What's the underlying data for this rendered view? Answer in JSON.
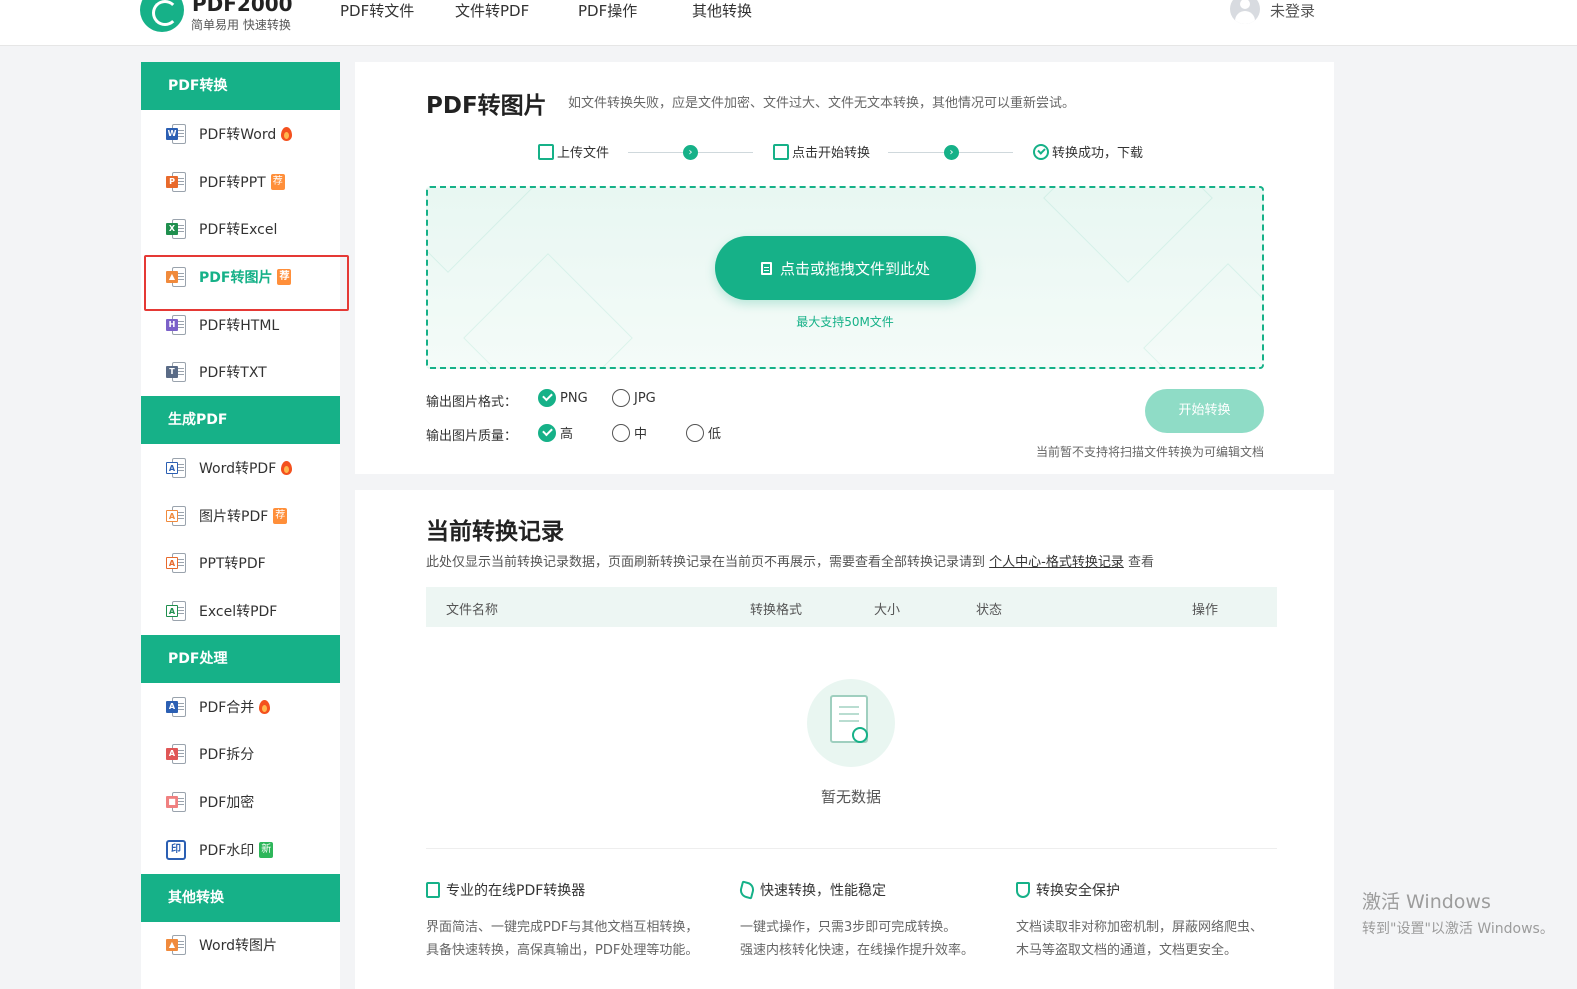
{
  "header": {
    "brand_name": "PDF2000",
    "brand_slogan": "简单易用 快速转换",
    "nav": [
      "PDF转文件",
      "文件转PDF",
      "PDF操作",
      "其他转换"
    ],
    "user_label": "未登录"
  },
  "sidebar": {
    "sections": [
      {
        "title": "PDF转换",
        "items": [
          {
            "label": "PDF转Word",
            "icon": "word-file-icon",
            "badge": "fire"
          },
          {
            "label": "PDF转PPT",
            "icon": "ppt-file-icon",
            "badge": "荐"
          },
          {
            "label": "PDF转Excel",
            "icon": "excel-file-icon",
            "badge": ""
          },
          {
            "label": "PDF转图片",
            "icon": "image-file-icon",
            "badge": "荐",
            "active": true
          },
          {
            "label": "PDF转HTML",
            "icon": "html-file-icon",
            "badge": ""
          },
          {
            "label": "PDF转TXT",
            "icon": "txt-file-icon",
            "badge": ""
          }
        ]
      },
      {
        "title": "生成PDF",
        "items": [
          {
            "label": "Word转PDF",
            "icon": "word-to-pdf-icon",
            "badge": "fire"
          },
          {
            "label": "图片转PDF",
            "icon": "image-to-pdf-icon",
            "badge": "荐"
          },
          {
            "label": "PPT转PDF",
            "icon": "ppt-to-pdf-icon",
            "badge": ""
          },
          {
            "label": "Excel转PDF",
            "icon": "excel-to-pdf-icon",
            "badge": ""
          }
        ]
      },
      {
        "title": "PDF处理",
        "items": [
          {
            "label": "PDF合并",
            "icon": "pdf-merge-icon",
            "badge": "fire"
          },
          {
            "label": "PDF拆分",
            "icon": "pdf-split-icon",
            "badge": ""
          },
          {
            "label": "PDF加密",
            "icon": "pdf-lock-icon",
            "badge": ""
          },
          {
            "label": "PDF水印",
            "icon": "watermark-icon",
            "badge": "新"
          }
        ]
      },
      {
        "title": "其他转换",
        "items": [
          {
            "label": "Word转图片",
            "icon": "word-to-image-icon",
            "badge": ""
          }
        ]
      }
    ]
  },
  "converter": {
    "title": "PDF转图片",
    "tip": "如文件转换失败，应是文件加密、文件过大、文件无文本转换，其他情况可以重新尝试。",
    "steps": [
      "上传文件",
      "点击开始转换",
      "转换成功，下载"
    ],
    "upload_label": "点击或拖拽文件到此处",
    "size_tip": "最大支持50M文件",
    "format_label": "输出图片格式：",
    "formats": [
      "PNG",
      "JPG"
    ],
    "format_selected": "PNG",
    "quality_label": "输出图片质量：",
    "qualities": [
      "高",
      "中",
      "低"
    ],
    "quality_selected": "高",
    "start_label": "开始转换",
    "scan_tip": "当前暂不支持将扫描文件转换为可编辑文档"
  },
  "records": {
    "title": "当前转换记录",
    "desc_prefix": "此处仅显示当前转换记录数据，页面刷新转换记录在当前页不再展示，需要查看全部转换记录请到 ",
    "desc_link": "个人中心-格式转换记录",
    "desc_suffix": " 查看",
    "columns": [
      "文件名称",
      "转换格式",
      "大小",
      "状态",
      "操作"
    ],
    "empty_text": "暂无数据"
  },
  "features": [
    {
      "title": "专业的在线PDF转换器",
      "lines": [
        "界面简洁、一键完成PDF与其他文档互相转换，",
        "具备快速转换，高保真输出，PDF处理等功能。"
      ]
    },
    {
      "title": "快速转换，性能稳定",
      "lines": [
        "一键式操作，只需3步即可完成转换。",
        "强速内核转化快速，在线操作提升效率。"
      ]
    },
    {
      "title": "转换安全保护",
      "lines": [
        "文档读取非对称加密机制，屏蔽网络爬虫、",
        "木马等盗取文档的通道，文档更安全。"
      ]
    }
  ],
  "windows_activation": {
    "line1": "激活 Windows",
    "line2": "转到\"设置\"以激活 Windows。"
  },
  "colors": {
    "accent": "#16b188",
    "hot": "#f4511e",
    "recommend": "#ff8f3a",
    "new": "#2eb65a",
    "highlight_border": "#e53935"
  }
}
